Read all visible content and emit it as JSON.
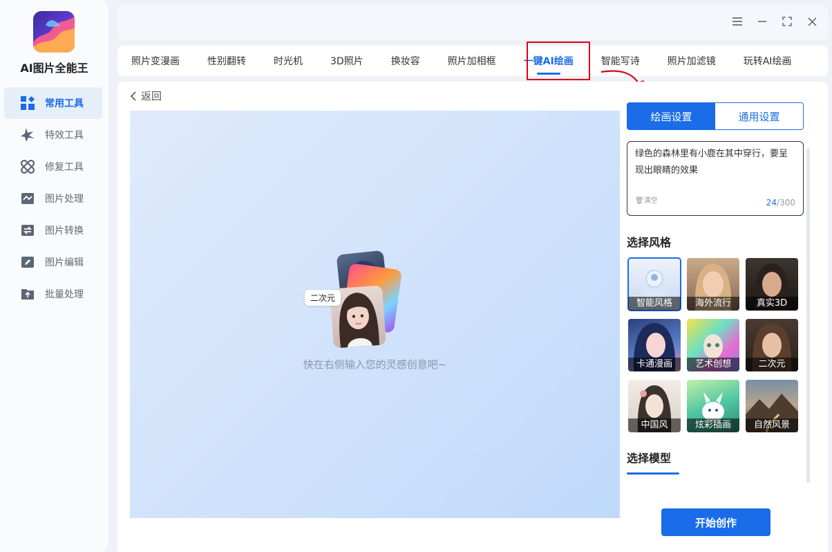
{
  "app": {
    "name": "AI图片全能王"
  },
  "sidebar": {
    "items": [
      {
        "label": "常用工具",
        "icon": "grid-tools-icon",
        "active": true
      },
      {
        "label": "特效工具",
        "icon": "star-burst-icon"
      },
      {
        "label": "修复工具",
        "icon": "bandage-icon"
      },
      {
        "label": "图片处理",
        "icon": "image-wave-icon"
      },
      {
        "label": "图片转换",
        "icon": "convert-icon"
      },
      {
        "label": "图片编辑",
        "icon": "edit-image-icon"
      },
      {
        "label": "批量处理",
        "icon": "folder-upload-icon"
      }
    ]
  },
  "window": {
    "controls": [
      "menu-icon",
      "minimize-icon",
      "fullscreen-icon",
      "close-icon"
    ]
  },
  "tabs": [
    {
      "label": "照片变漫画"
    },
    {
      "label": "性别翻转"
    },
    {
      "label": "时光机"
    },
    {
      "label": "3D照片"
    },
    {
      "label": "换妆容"
    },
    {
      "label": "照片加相框"
    },
    {
      "label": "一键AI绘画",
      "active": true
    },
    {
      "label": "智能写诗"
    },
    {
      "label": "照片加滤镜"
    },
    {
      "label": "玩转AI绘画"
    }
  ],
  "main": {
    "back_label": "返回",
    "preview_tag": "二次元",
    "hint": "快在右侧输入您的灵感创意吧~"
  },
  "panel": {
    "seg_tabs": [
      {
        "label": "绘画设置",
        "active": true
      },
      {
        "label": "通用设置"
      }
    ],
    "prompt_text": "绿色的森林里有小鹿在其中穿行，要呈现出眼睛的效果",
    "clear_label": "清空",
    "count_current": "24",
    "count_max": "/300",
    "style_title": "选择风格",
    "styles": [
      {
        "label": "智能风格",
        "selected": true
      },
      {
        "label": "海外流行"
      },
      {
        "label": "真实3D"
      },
      {
        "label": "卡通漫画"
      },
      {
        "label": "艺术创想"
      },
      {
        "label": "二次元"
      },
      {
        "label": "中国风"
      },
      {
        "label": "炫彩插画"
      },
      {
        "label": "自然风景"
      }
    ],
    "model_title": "选择模型",
    "start_label": "开始创作"
  },
  "colors": {
    "accent": "#1a6ce8",
    "highlight_box": "#d9001b"
  }
}
